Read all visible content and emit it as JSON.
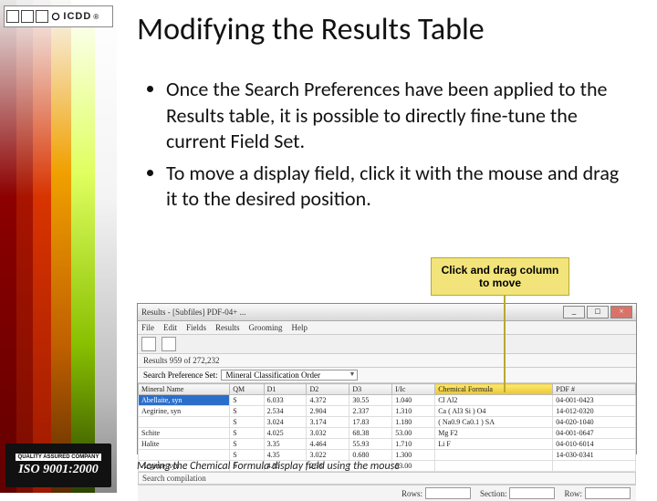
{
  "logo": {
    "text": "ICDD",
    "reg": "®"
  },
  "badge": {
    "q": "QUALITY ASSURED COMPANY",
    "iso": "ISO 9001:2000"
  },
  "title": "Modifying the Results Table",
  "bullets": [
    "Once the Search Preferences have been applied to the Results table, it is possible to directly fine-tune the current Field Set.",
    "To move a display field, click it with the mouse and drag it to the desired position."
  ],
  "callout": "Click and drag column to move",
  "window": {
    "title": "Results - [Subfiles] PDF-04+ ...",
    "min": "_",
    "max": "□",
    "close": "×",
    "menu": [
      "File",
      "Edit",
      "Fields",
      "Results",
      "Grooming",
      "Help"
    ],
    "count": "Results 959 of 272,232",
    "pref_label": "Search Preference Set:",
    "pref_value": "Mineral Classification Order",
    "headers": [
      "Mineral Name",
      "QM",
      "D1",
      "D2",
      "D3",
      "I/Ic",
      "Chemical Formula",
      "PDF #"
    ],
    "rows": [
      [
        "Abellaite, syn",
        "S",
        "6.033",
        "4.372",
        "30.55",
        "1.040",
        "Cl Al2",
        "04-001-0423"
      ],
      [
        "Aegirine, syn",
        "S",
        "2.534",
        "2.904",
        "2.337",
        "1.310",
        "Ca ( Al3 Si ) O4",
        "14-012-0320"
      ],
      [
        "",
        "S",
        "3.024",
        "3.174",
        "17.83",
        "1.180",
        "( Na0.9 Ca0.1 ) SA",
        "04-020-1040"
      ],
      [
        "Schite",
        "S",
        "4.025",
        "3.032",
        "68.38",
        "53.00",
        "Mg F2",
        "04-001-0647"
      ],
      [
        "Halite",
        "S",
        "3.35",
        "4.464",
        "55.93",
        "1.710",
        "Li F",
        "04-010-6014"
      ],
      [
        "",
        "S",
        "4.35",
        "3.022",
        "0.680",
        "1.300",
        "",
        "14-030-0341"
      ],
      [
        "Aegirite, syn",
        "S",
        "4.35",
        "2.36",
        "",
        "53.00",
        "",
        ""
      ]
    ],
    "search_label": "Search compilation",
    "bottom": {
      "rows": "Rows:",
      "section": "Section:",
      "row": "Row:"
    }
  },
  "caption": "Moving the Chemical Formula display field using the mouse"
}
